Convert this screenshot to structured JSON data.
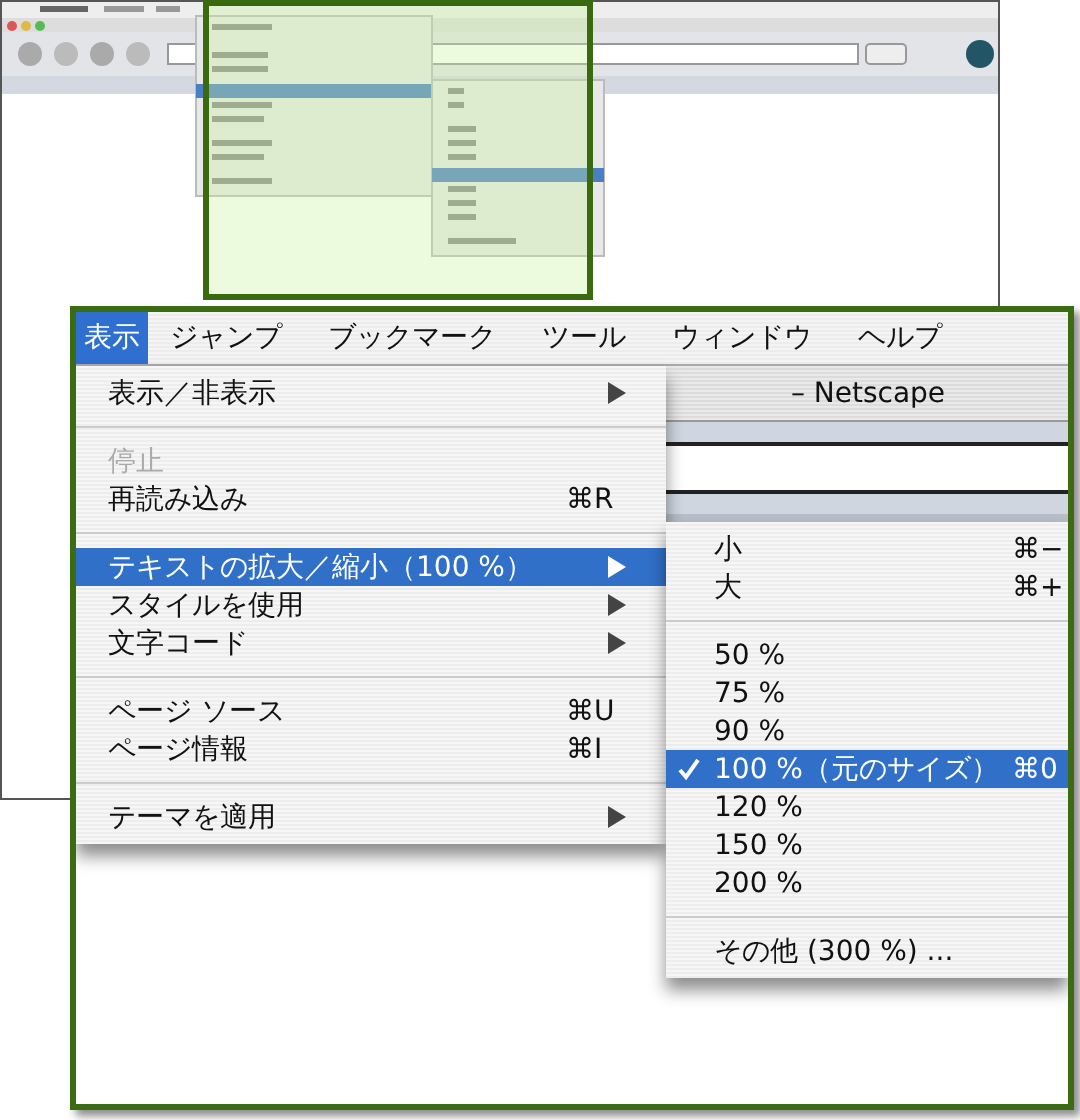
{
  "menubar": [
    {
      "label": "表示",
      "selected": true
    },
    {
      "label": "ジャンプ",
      "selected": false
    },
    {
      "label": "ブックマーク",
      "selected": false
    },
    {
      "label": "ツール",
      "selected": false
    },
    {
      "label": "ウィンドウ",
      "selected": false
    },
    {
      "label": "ヘルプ",
      "selected": false
    }
  ],
  "window": {
    "title": "– Netscape"
  },
  "menu": {
    "items": [
      {
        "kind": "item",
        "label": "表示／非表示",
        "submenu": true,
        "disabled": false,
        "selected": false
      },
      {
        "kind": "separator"
      },
      {
        "kind": "item",
        "label": "停止",
        "submenu": false,
        "disabled": true,
        "selected": false
      },
      {
        "kind": "item",
        "label": "再読み込み",
        "shortcut": "⌘R",
        "submenu": false,
        "disabled": false,
        "selected": false
      },
      {
        "kind": "separator"
      },
      {
        "kind": "item",
        "label": "テキストの拡大／縮小（100 %）",
        "submenu": true,
        "disabled": false,
        "selected": true
      },
      {
        "kind": "item",
        "label": "スタイルを使用",
        "submenu": true,
        "disabled": false,
        "selected": false
      },
      {
        "kind": "item",
        "label": "文字コード",
        "submenu": true,
        "disabled": false,
        "selected": false
      },
      {
        "kind": "separator"
      },
      {
        "kind": "item",
        "label": "ページ ソース",
        "shortcut": "⌘U",
        "submenu": false,
        "disabled": false,
        "selected": false
      },
      {
        "kind": "item",
        "label": "ページ情報",
        "shortcut": "⌘I",
        "submenu": false,
        "disabled": false,
        "selected": false
      },
      {
        "kind": "separator"
      },
      {
        "kind": "item",
        "label": "テーマを適用",
        "submenu": true,
        "disabled": false,
        "selected": false
      }
    ]
  },
  "submenu": {
    "items": [
      {
        "kind": "item",
        "label": "小",
        "shortcut": "⌘−",
        "checked": false,
        "selected": false
      },
      {
        "kind": "item",
        "label": "大",
        "shortcut": "⌘+",
        "checked": false,
        "selected": false
      },
      {
        "kind": "separator"
      },
      {
        "kind": "item",
        "label": "50 %",
        "checked": false,
        "selected": false
      },
      {
        "kind": "item",
        "label": "75 %",
        "checked": false,
        "selected": false
      },
      {
        "kind": "item",
        "label": "90 %",
        "checked": false,
        "selected": false
      },
      {
        "kind": "item",
        "label": "100 %（元のサイズ）",
        "shortcut": "⌘0",
        "checked": true,
        "selected": true
      },
      {
        "kind": "item",
        "label": "120 %",
        "checked": false,
        "selected": false
      },
      {
        "kind": "item",
        "label": "150 %",
        "checked": false,
        "selected": false
      },
      {
        "kind": "item",
        "label": "200 %",
        "checked": false,
        "selected": false
      },
      {
        "kind": "separator"
      },
      {
        "kind": "item",
        "label": "その他 (300 %) ...",
        "checked": false,
        "selected": false
      }
    ]
  }
}
